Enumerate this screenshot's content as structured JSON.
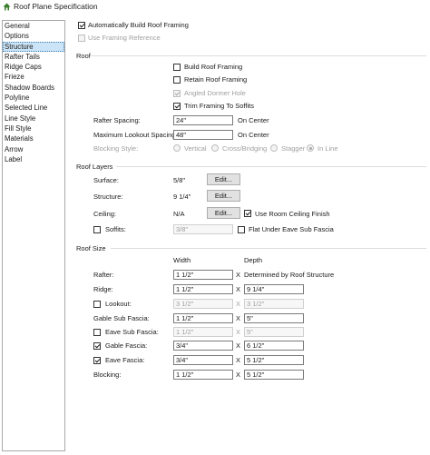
{
  "window": {
    "title": "Roof Plane Specification"
  },
  "sidebar": {
    "items": [
      {
        "label": "General"
      },
      {
        "label": "Options"
      },
      {
        "label": "Structure"
      },
      {
        "label": "Rafter Tails"
      },
      {
        "label": "Ridge Caps"
      },
      {
        "label": "Frieze"
      },
      {
        "label": "Shadow Boards"
      },
      {
        "label": "Polyline"
      },
      {
        "label": "Selected Line"
      },
      {
        "label": "Line Style"
      },
      {
        "label": "Fill Style"
      },
      {
        "label": "Materials"
      },
      {
        "label": "Arrow"
      },
      {
        "label": "Label"
      }
    ],
    "active_index": 2
  },
  "top": {
    "auto_build_label": "Automatically Build Roof Framing",
    "auto_build_checked": true,
    "use_framing_ref_label": "Use Framing Reference",
    "use_framing_ref_checked": false
  },
  "roof": {
    "section_label": "Roof",
    "build_roof_framing_label": "Build Roof Framing",
    "build_roof_framing_checked": false,
    "retain_roof_framing_label": "Retain Roof Framing",
    "retain_roof_framing_checked": false,
    "angled_dormer_hole_label": "Angled Dormer Hole",
    "angled_dormer_hole_checked": true,
    "trim_framing_label": "Trim Framing To Soffits",
    "trim_framing_checked": true,
    "rafter_spacing_label": "Rafter Spacing:",
    "rafter_spacing_value": "24\"",
    "rafter_spacing_unit": "On Center",
    "max_lookout_label": "Maximum Lookout Spacing:",
    "max_lookout_value": "48\"",
    "max_lookout_unit": "On Center",
    "blocking_style_label": "Blocking Style:",
    "blocking_options": [
      "Vertical",
      "Cross/Bridging",
      "Stagger",
      "In Line"
    ],
    "blocking_selected": "In Line"
  },
  "layers": {
    "section_label": "Roof Layers",
    "surface_label": "Surface:",
    "surface_value": "5/8\"",
    "structure_label": "Structure:",
    "structure_value": "9 1/4\"",
    "ceiling_label": "Ceiling:",
    "ceiling_value": "N/A",
    "edit_label": "Edit...",
    "use_room_ceiling_label": "Use Room Ceiling Finish",
    "use_room_ceiling_checked": true,
    "soffits_label": "Soffits:",
    "soffits_checked": false,
    "soffits_value": "3/8\"",
    "flat_under_eave_label": "Flat Under Eave Sub Fascia",
    "flat_under_eave_checked": false
  },
  "size": {
    "section_label": "Roof Size",
    "width_header": "Width",
    "depth_header": "Depth",
    "x_symbol": "X",
    "rows": [
      {
        "label": "Rafter:",
        "has_check": false,
        "checked": false,
        "enabled": true,
        "width": "1 1/2\"",
        "depth": "Determined by Roof Structure",
        "depth_is_text": true
      },
      {
        "label": "Ridge:",
        "has_check": false,
        "checked": false,
        "enabled": true,
        "width": "1 1/2\"",
        "depth": "9 1/4\"",
        "depth_is_text": false
      },
      {
        "label": "Lookout:",
        "has_check": true,
        "checked": false,
        "enabled": false,
        "width": "3 1/2\"",
        "depth": "3 1/2\"",
        "depth_is_text": false
      },
      {
        "label": "Gable Sub Fascia:",
        "has_check": false,
        "checked": false,
        "enabled": true,
        "width": "1 1/2\"",
        "depth": "5\"",
        "depth_is_text": false
      },
      {
        "label": "Eave Sub Fascia:",
        "has_check": true,
        "checked": false,
        "enabled": false,
        "width": "1 1/2\"",
        "depth": "5\"",
        "depth_is_text": false
      },
      {
        "label": "Gable Fascia:",
        "has_check": true,
        "checked": true,
        "enabled": true,
        "width": "3/4\"",
        "depth": "6 1/2\"",
        "depth_is_text": false
      },
      {
        "label": "Eave Fascia:",
        "has_check": true,
        "checked": true,
        "enabled": true,
        "width": "3/4\"",
        "depth": "5 1/2\"",
        "depth_is_text": false
      },
      {
        "label": "Blocking:",
        "has_check": false,
        "checked": false,
        "enabled": true,
        "width": "1 1/2\"",
        "depth": "5 1/2\"",
        "depth_is_text": false
      }
    ]
  }
}
